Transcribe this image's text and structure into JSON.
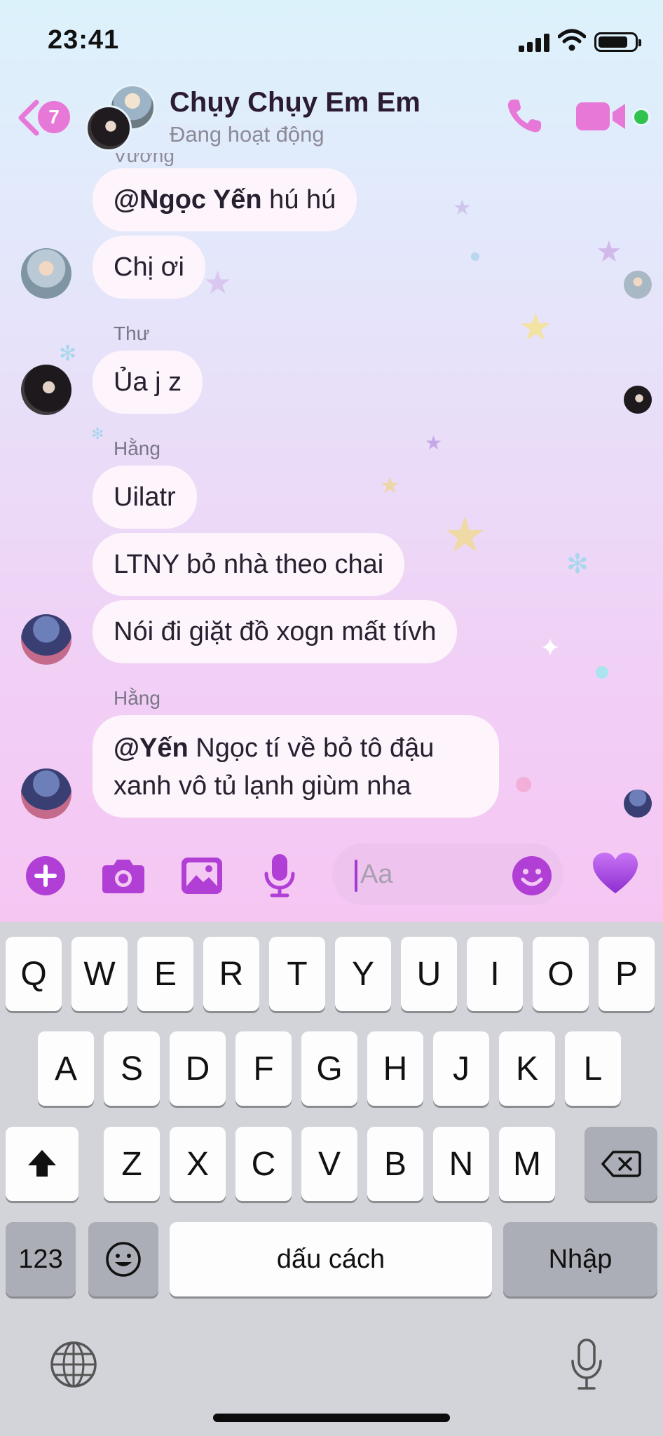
{
  "status_bar": {
    "time": "23:41",
    "battery_icon": "battery-icon",
    "wifi_icon": "wifi-icon",
    "signal_icon": "signal-icon"
  },
  "header": {
    "back_badge": "7",
    "title": "Chụy Chụy Em Em",
    "subtitle": "Đang hoạt động",
    "icons": [
      "back-chevron-icon",
      "phone-icon",
      "video-camera-icon"
    ],
    "online_color": "#31c24d"
  },
  "messages": {
    "m1": {
      "mention": "@Ngọc Yến",
      "text": " hú hú"
    },
    "m2": {
      "text": "Chị ơi"
    },
    "sender_thu": "Thư",
    "m3": {
      "text": "Ủa j z"
    },
    "sender_hang1": "Hằng",
    "m4": {
      "text": "Uilatr"
    },
    "m5": {
      "text": "LTNY bỏ nhà theo chai"
    },
    "m6": {
      "text": "Nói đi giặt đồ xogn mất tívh"
    },
    "sender_hang2": "Hằng",
    "m7": {
      "mention": "@Yến",
      "text": " Ngọc tí về bỏ tô đậu xanh vô tủ lạnh giùm nha"
    }
  },
  "composer": {
    "placeholder": "Aa",
    "icons": [
      "plus-circle-icon",
      "camera-icon",
      "image-icon",
      "microphone-icon",
      "smiley-icon",
      "heart-icon"
    ],
    "accent": "#b13fd6"
  },
  "keyboard": {
    "row1": [
      "Q",
      "W",
      "E",
      "R",
      "T",
      "Y",
      "U",
      "I",
      "O",
      "P"
    ],
    "row2": [
      "A",
      "S",
      "D",
      "F",
      "G",
      "H",
      "J",
      "K",
      "L"
    ],
    "row3": [
      "Z",
      "X",
      "C",
      "V",
      "B",
      "N",
      "M"
    ],
    "numbers_key": "123",
    "space_key": "dấu cách",
    "return_key": "Nhập",
    "icons": [
      "shift-icon",
      "backspace-icon",
      "emoji-icon",
      "globe-icon",
      "dictation-icon"
    ]
  }
}
